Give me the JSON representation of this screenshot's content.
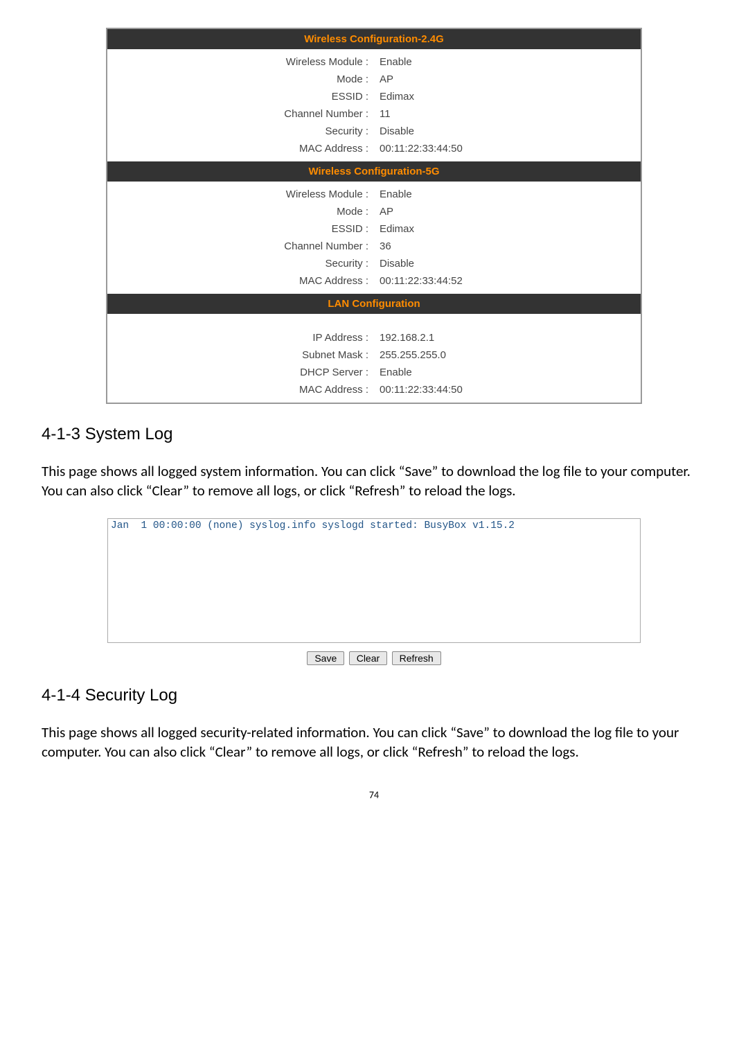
{
  "config_24g": {
    "header": "Wireless Configuration-2.4G",
    "rows": [
      {
        "label": "Wireless Module :",
        "value": "Enable"
      },
      {
        "label": "Mode :",
        "value": "AP"
      },
      {
        "label": "ESSID :",
        "value": "Edimax"
      },
      {
        "label": "Channel Number :",
        "value": "11"
      },
      {
        "label": "Security :",
        "value": "Disable"
      },
      {
        "label": "MAC Address :",
        "value": "00:11:22:33:44:50"
      }
    ]
  },
  "config_5g": {
    "header": "Wireless Configuration-5G",
    "rows": [
      {
        "label": "Wireless Module :",
        "value": "Enable"
      },
      {
        "label": "Mode :",
        "value": "AP"
      },
      {
        "label": "ESSID :",
        "value": "Edimax"
      },
      {
        "label": "Channel Number :",
        "value": "36"
      },
      {
        "label": "Security :",
        "value": "Disable"
      },
      {
        "label": "MAC Address :",
        "value": "00:11:22:33:44:52"
      }
    ]
  },
  "config_lan": {
    "header": "LAN Configuration",
    "rows": [
      {
        "label": "IP Address :",
        "value": "192.168.2.1"
      },
      {
        "label": "Subnet Mask :",
        "value": "255.255.255.0"
      },
      {
        "label": "DHCP Server :",
        "value": "Enable"
      },
      {
        "label": "MAC Address :",
        "value": "00:11:22:33:44:50"
      }
    ]
  },
  "section_413": {
    "heading": "4-1-3 System Log",
    "body": "This page shows all logged system information. You can click “Save” to download the log file to your computer. You can also click “Clear” to remove all logs, or click “Refresh” to reload the logs."
  },
  "syslog": {
    "content": "Jan  1 00:00:00 (none) syslog.info syslogd started: BusyBox v1.15.2",
    "buttons": {
      "save": "Save",
      "clear": "Clear",
      "refresh": "Refresh"
    }
  },
  "section_414": {
    "heading": "4-1-4 Security Log",
    "body": "This page shows all logged security-related information. You can click “Save” to download the log file to your computer. You can also click “Clear” to remove all logs, or click “Refresh” to reload the logs."
  },
  "page_number": "74"
}
